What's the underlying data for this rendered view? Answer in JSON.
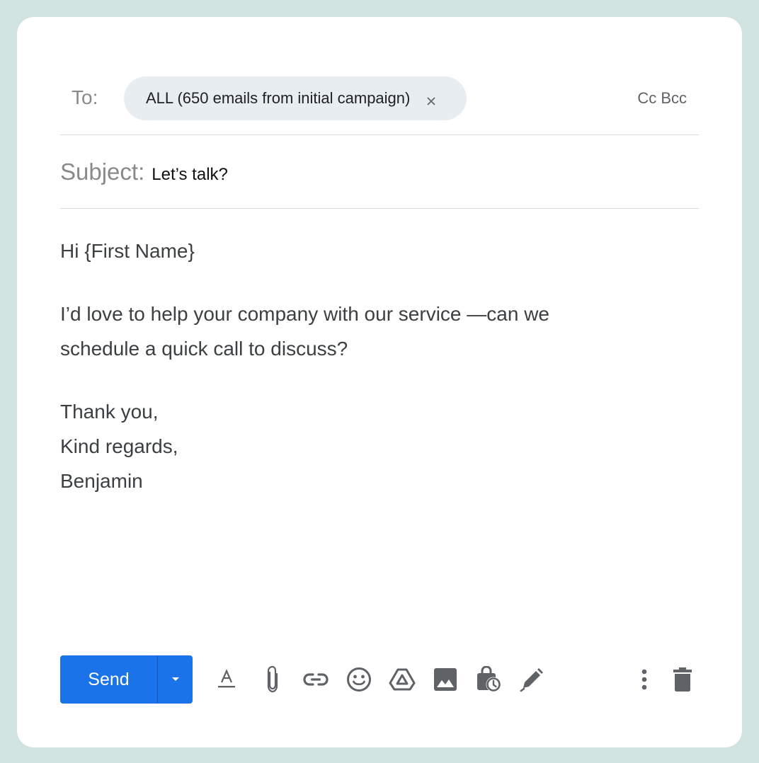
{
  "compose": {
    "to_label": "To:",
    "recipient_chip": "ALL (650 emails from initial campaign)",
    "cc_bcc": "Cc Bcc",
    "subject_label": "Subject:",
    "subject_value": "Let’s talk?",
    "body": {
      "greeting": "Hi {First Name}",
      "message_line1": "I’d love to help your company with our service —can we",
      "message_line2": "schedule a quick call to discuss?",
      "closing1": "Thank you,",
      "closing2": "Kind regards,",
      "signature": "Benjamin"
    }
  },
  "toolbar": {
    "send_label": "Send",
    "icons": [
      "formatting-icon",
      "attach-icon",
      "link-icon",
      "emoji-icon",
      "drive-icon",
      "photo-icon",
      "confidential-icon",
      "signature-icon",
      "more-options-icon",
      "discard-icon"
    ]
  },
  "colors": {
    "frame": "#d1e3e0",
    "card": "#ffffff",
    "chip": "#e8edf1",
    "send": "#1a73e8",
    "icon": "#5f6368"
  }
}
